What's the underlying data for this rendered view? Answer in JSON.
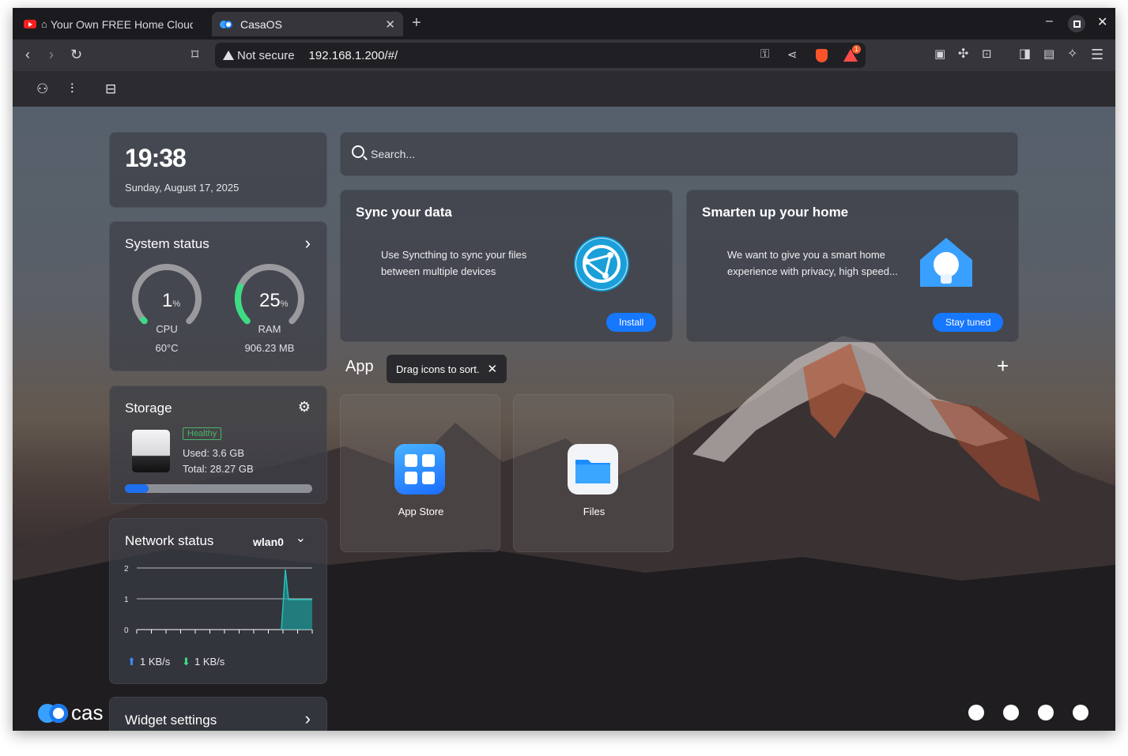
{
  "browser": {
    "tabs": [
      {
        "label": "Your Own FREE Home Cloud",
        "active": false
      },
      {
        "label": "CasaOS",
        "active": true
      }
    ],
    "address": {
      "security": "Not secure",
      "url": "192.168.1.200/#/"
    },
    "brave_badge": "1"
  },
  "clock": {
    "time": "19:38",
    "date": "Sunday, August 17, 2025"
  },
  "system_status": {
    "title": "System status",
    "cpu": {
      "value": "1",
      "unit": "%",
      "label": "CPU",
      "detail": "60°C",
      "percent": 1
    },
    "ram": {
      "value": "25",
      "unit": "%",
      "label": "RAM",
      "detail": "906.23 MB",
      "percent": 25
    }
  },
  "storage": {
    "title": "Storage",
    "health": "Healthy",
    "used": "Used: 3.6 GB",
    "total": "Total: 28.27 GB",
    "used_fraction": 0.127
  },
  "network": {
    "title": "Network status",
    "interface": "wlan0",
    "y_ticks": [
      "2",
      "1",
      "0"
    ],
    "upload": "1 KB/s",
    "download": "1 KB/s"
  },
  "widget_settings": {
    "label": "Widget settings"
  },
  "brand": {
    "text": "cas"
  },
  "search": {
    "placeholder": "Search..."
  },
  "cards": [
    {
      "title": "Sync your data",
      "description": "Use Syncthing to sync your files between multiple devices",
      "button": "Install"
    },
    {
      "title": "Smarten up your home",
      "description": "We want to give you a smart home experience with privacy, high speed...",
      "button": "Stay tuned"
    }
  ],
  "apps_section": {
    "title": "App",
    "tooltip": "Drag icons to sort."
  },
  "apps": [
    {
      "label": "App Store"
    },
    {
      "label": "Files"
    }
  ],
  "colors": {
    "accent": "#1677ff",
    "healthy": "#46b867",
    "gauge_green": "#3ddc84"
  }
}
